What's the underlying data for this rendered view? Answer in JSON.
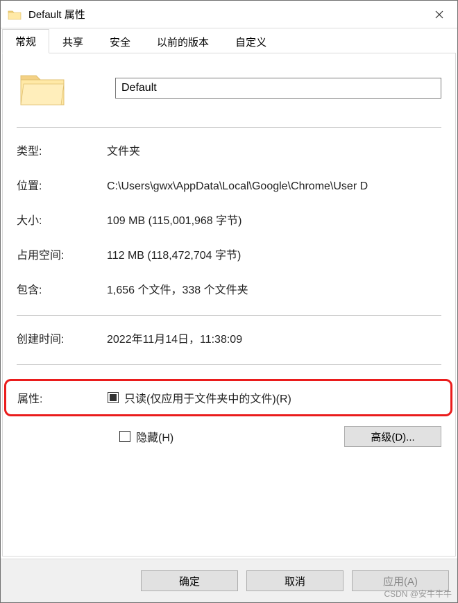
{
  "window": {
    "title": "Default 属性",
    "close": "×"
  },
  "tabs": {
    "general": "常规",
    "share": "共享",
    "security": "安全",
    "previous": "以前的版本",
    "customize": "自定义"
  },
  "header": {
    "name_value": "Default"
  },
  "properties": {
    "type_label": "类型:",
    "type_value": "文件夹",
    "location_label": "位置:",
    "location_value": "C:\\Users\\gwx\\AppData\\Local\\Google\\Chrome\\User D",
    "size_label": "大小:",
    "size_value": "109 MB (115,001,968 字节)",
    "size_on_disk_label": "占用空间:",
    "size_on_disk_value": "112 MB (118,472,704 字节)",
    "contains_label": "包含:",
    "contains_value": "1,656 个文件，338 个文件夹",
    "created_label": "创建时间:",
    "created_value": "2022年11月14日，11:38:09"
  },
  "attributes": {
    "label": "属性:",
    "readonly_label": "只读(仅应用于文件夹中的文件)(R)",
    "hidden_label": "隐藏(H)",
    "advanced_button": "高级(D)..."
  },
  "buttons": {
    "ok": "确定",
    "cancel": "取消",
    "apply": "应用(A)"
  },
  "watermark": "CSDN @安牛牛牛"
}
